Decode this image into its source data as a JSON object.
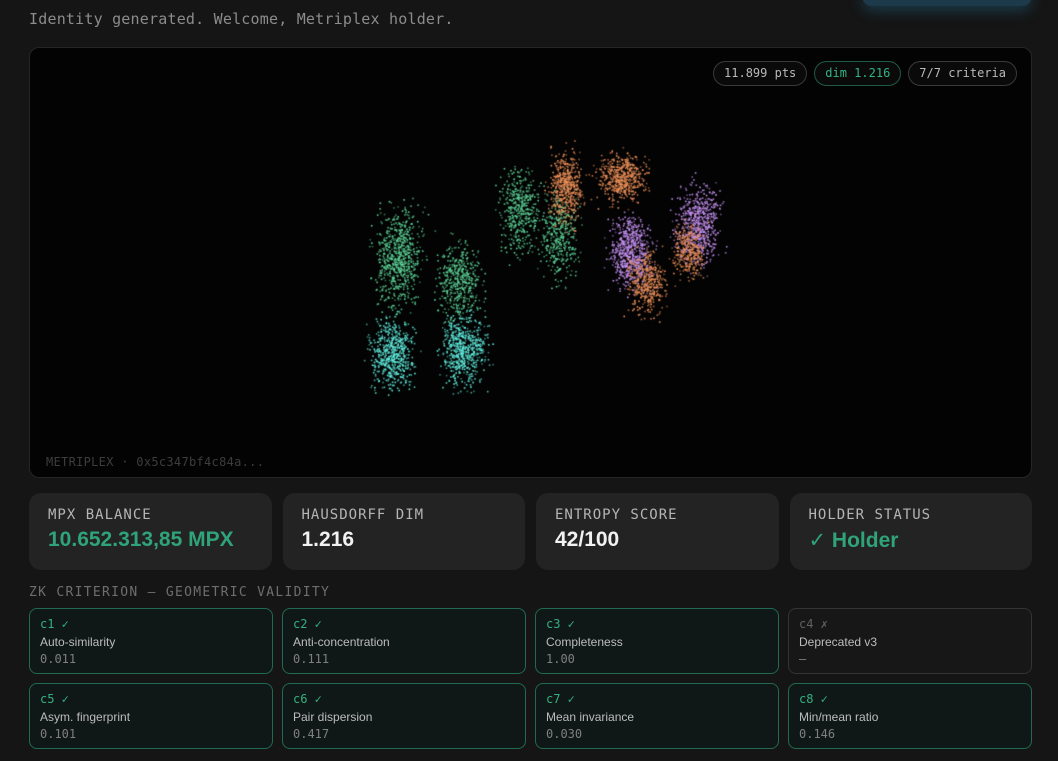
{
  "welcome_text": "Identity generated. Welcome, Metriplex holder.",
  "visual": {
    "points_chip": "11.899 pts",
    "dim_chip": "dim 1.216",
    "criteria_chip": "7/7 criteria",
    "caption": "METRIPLEX · 0x5c347bf4c84a..."
  },
  "stats": [
    {
      "label": "MPX BALANCE",
      "value": "10.652.313,85 MPX"
    },
    {
      "label": "HAUSDORFF DIM",
      "value": "1.216"
    },
    {
      "label": "ENTROPY SCORE",
      "value": "42/100"
    },
    {
      "label": "HOLDER STATUS",
      "value": "✓ Holder"
    }
  ],
  "section_title": "ZK CRITERION — GEOMETRIC VALIDITY",
  "criteria": [
    {
      "id": "c1 ✓",
      "name": "Auto-similarity",
      "value": "0.011"
    },
    {
      "id": "c2 ✓",
      "name": "Anti-concentration",
      "value": "0.111"
    },
    {
      "id": "c3 ✓",
      "name": "Completeness",
      "value": "1.00"
    },
    {
      "id": "c4 ✗",
      "name": "Deprecated v3",
      "value": "—"
    },
    {
      "id": "c5 ✓",
      "name": "Asym. fingerprint",
      "value": "0.101"
    },
    {
      "id": "c6 ✓",
      "name": "Pair dispersion",
      "value": "0.417"
    },
    {
      "id": "c7 ✓",
      "name": "Mean invariance",
      "value": "0.030"
    },
    {
      "id": "c8 ✓",
      "name": "Min/mean ratio",
      "value": "0.146"
    }
  ],
  "colors": {
    "accent_green": "#2fa37a",
    "cluster_green": "#5fd89a",
    "cluster_cyan": "#62efe0",
    "cluster_orange": "#f0925a",
    "cluster_violet": "#c792f4"
  }
}
